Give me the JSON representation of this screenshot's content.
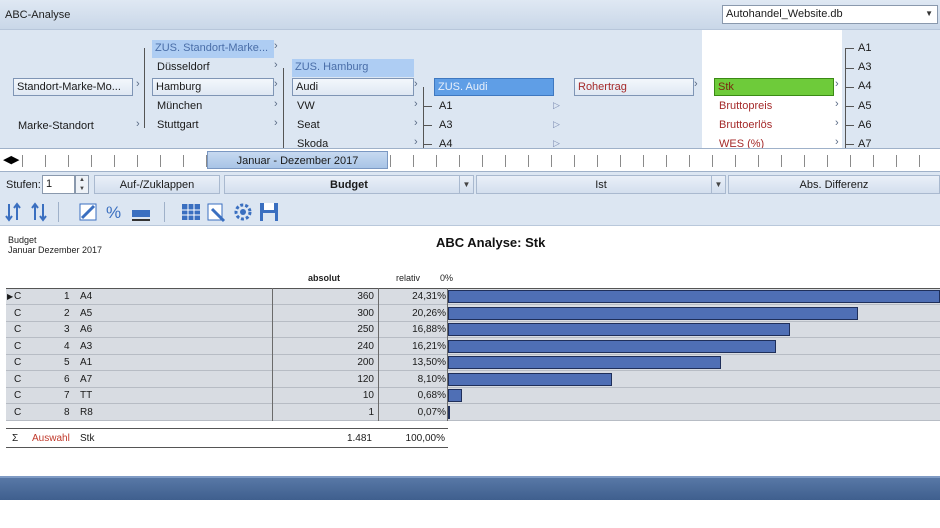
{
  "window": {
    "title": "ABC-Analyse"
  },
  "database": {
    "selected": "Autohandel_Website.db"
  },
  "dimensions": {
    "col1": [
      "Standort-Marke-Mo...",
      "Marke-Standort"
    ],
    "col2": [
      "ZUS. Standort-Marke...",
      "Düsseldorf",
      "Hamburg",
      "München",
      "Stuttgart"
    ],
    "col3": [
      "ZUS. Hamburg",
      "Audi",
      "VW",
      "Seat",
      "Skoda"
    ],
    "col4": [
      "ZUS. Audi",
      "A1",
      "A3",
      "A4"
    ],
    "col5": [
      "Rohertrag"
    ],
    "col6": [
      "Stk",
      "Bruttopreis",
      "Bruttoerlös",
      "WES (%)"
    ],
    "col7": [
      "A1",
      "A3",
      "A4",
      "A5",
      "A6",
      "A7"
    ]
  },
  "timeline": {
    "range_label": "Januar - Dezember 2017",
    "prev_icon": "arrow-left-icon",
    "next_icon": "arrow-right-icon"
  },
  "controls": {
    "stufen_label": "Stufen:",
    "stufen_value": "1",
    "collapse_label": "Auf-/Zuklappen",
    "budget_label": "Budget",
    "ist_label": "Ist",
    "diff_label": "Abs. Differenz"
  },
  "report": {
    "scenario": "Budget",
    "period": "Januar   Dezember 2017",
    "title": "ABC Analyse: Stk",
    "col_absolut": "absolut",
    "col_relativ": "relativ",
    "col_zero": "0%",
    "bar_color": "#4f6fb5",
    "rows": [
      {
        "cls": "C",
        "rank": "1",
        "name": "A4",
        "absolut": "360",
        "relativ": "24,31%",
        "share": 0.2431
      },
      {
        "cls": "C",
        "rank": "2",
        "name": "A5",
        "absolut": "300",
        "relativ": "20,26%",
        "share": 0.2026
      },
      {
        "cls": "C",
        "rank": "3",
        "name": "A6",
        "absolut": "250",
        "relativ": "16,88%",
        "share": 0.1688
      },
      {
        "cls": "C",
        "rank": "4",
        "name": "A3",
        "absolut": "240",
        "relativ": "16,21%",
        "share": 0.1621
      },
      {
        "cls": "C",
        "rank": "5",
        "name": "A1",
        "absolut": "200",
        "relativ": "13,50%",
        "share": 0.135
      },
      {
        "cls": "C",
        "rank": "6",
        "name": "A7",
        "absolut": "120",
        "relativ": "8,10%",
        "share": 0.081
      },
      {
        "cls": "C",
        "rank": "7",
        "name": "TT",
        "absolut": "10",
        "relativ": "0,68%",
        "share": 0.0068
      },
      {
        "cls": "C",
        "rank": "8",
        "name": "R8",
        "absolut": "1",
        "relativ": "0,07%",
        "share": 0.0007
      }
    ],
    "sum": {
      "sigma": "Σ",
      "label": "Auswahl",
      "name": "Stk",
      "absolut": "1.481",
      "relativ": "100,00%"
    }
  }
}
